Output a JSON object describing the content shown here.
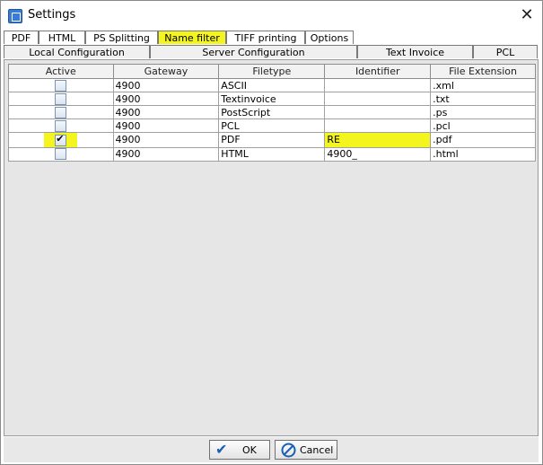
{
  "window": {
    "title": "Settings",
    "close_glyph": "✕"
  },
  "tabs_row1": [
    {
      "label": "PDF",
      "highlighted": false
    },
    {
      "label": "HTML",
      "highlighted": false
    },
    {
      "label": "PS Splitting",
      "highlighted": false
    },
    {
      "label": "Name filter",
      "highlighted": true
    },
    {
      "label": "TIFF printing",
      "highlighted": false
    },
    {
      "label": "Options",
      "highlighted": false
    }
  ],
  "tabs_row2": [
    {
      "label": "Local Configuration"
    },
    {
      "label": "Server Configuration"
    },
    {
      "label": "Text Invoice"
    },
    {
      "label": "PCL"
    }
  ],
  "table": {
    "columns": [
      "Active",
      "Gateway",
      "Filetype",
      "Identifier",
      "File Extension"
    ],
    "rows": [
      {
        "active": false,
        "gateway": "4900",
        "filetype": "ASCII",
        "identifier": "",
        "extension": ".xml"
      },
      {
        "active": false,
        "gateway": "4900",
        "filetype": "Textinvoice",
        "identifier": "",
        "extension": ".txt"
      },
      {
        "active": false,
        "gateway": "4900",
        "filetype": "PostScript",
        "identifier": "",
        "extension": ".ps"
      },
      {
        "active": false,
        "gateway": "4900",
        "filetype": "PCL",
        "identifier": "",
        "extension": ".pcl"
      },
      {
        "active": true,
        "gateway": "4900",
        "filetype": "PDF",
        "identifier": "RE",
        "extension": ".pdf",
        "highlighted": true
      },
      {
        "active": false,
        "gateway": "4900",
        "filetype": "HTML",
        "identifier": "4900_",
        "extension": ".html"
      }
    ]
  },
  "buttons": {
    "ok_label": "OK",
    "cancel_label": "Cancel"
  },
  "colors": {
    "highlight": "#f4f51e",
    "ok_check": "#1a5fb4",
    "cancel_icon": "#1a5fb4"
  },
  "icons": {
    "app": "settings-app-icon",
    "ok": "checkmark-icon",
    "cancel": "no-entry-icon",
    "close": "close-icon"
  }
}
